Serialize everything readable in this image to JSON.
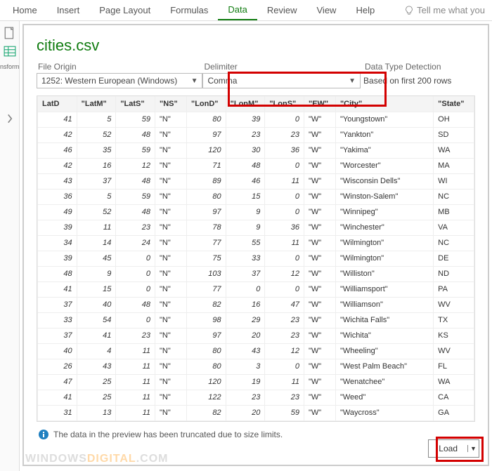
{
  "ribbon": {
    "tabs": [
      "Home",
      "Insert",
      "Page Layout",
      "Formulas",
      "Data",
      "Review",
      "View",
      "Help"
    ],
    "active_index": 4,
    "tell_me": "Tell me what you"
  },
  "leftbar": {
    "group_label": "nsform"
  },
  "dialog": {
    "title": "cities.csv",
    "file_origin": {
      "label": "File Origin",
      "value": "1252: Western European (Windows)"
    },
    "delimiter": {
      "label": "Delimiter",
      "value": "Comma"
    },
    "detection": {
      "label": "Data Type Detection",
      "value": "Based on first 200 rows"
    },
    "info": "The data in the preview has been truncated due to size limits.",
    "load_label": "Load"
  },
  "table": {
    "headers": [
      "LatD",
      "\"LatM\"",
      "\"LatS\"",
      "\"NS\"",
      "\"LonD\"",
      "\"LonM\"",
      "\"LonS\"",
      "\"EW\"",
      "\"City\"",
      "\"State\""
    ],
    "rows": [
      [
        41,
        5,
        59,
        "\"N\"",
        80,
        39,
        0,
        "\"W\"",
        "\"Youngstown\"",
        "OH"
      ],
      [
        42,
        52,
        48,
        "\"N\"",
        97,
        23,
        23,
        "\"W\"",
        "\"Yankton\"",
        "SD"
      ],
      [
        46,
        35,
        59,
        "\"N\"",
        120,
        30,
        36,
        "\"W\"",
        "\"Yakima\"",
        "WA"
      ],
      [
        42,
        16,
        12,
        "\"N\"",
        71,
        48,
        0,
        "\"W\"",
        "\"Worcester\"",
        "MA"
      ],
      [
        43,
        37,
        48,
        "\"N\"",
        89,
        46,
        11,
        "\"W\"",
        "\"Wisconsin Dells\"",
        "WI"
      ],
      [
        36,
        5,
        59,
        "\"N\"",
        80,
        15,
        0,
        "\"W\"",
        "\"Winston-Salem\"",
        "NC"
      ],
      [
        49,
        52,
        48,
        "\"N\"",
        97,
        9,
        0,
        "\"W\"",
        "\"Winnipeg\"",
        "MB"
      ],
      [
        39,
        11,
        23,
        "\"N\"",
        78,
        9,
        36,
        "\"W\"",
        "\"Winchester\"",
        "VA"
      ],
      [
        34,
        14,
        24,
        "\"N\"",
        77,
        55,
        11,
        "\"W\"",
        "\"Wilmington\"",
        "NC"
      ],
      [
        39,
        45,
        0,
        "\"N\"",
        75,
        33,
        0,
        "\"W\"",
        "\"Wilmington\"",
        "DE"
      ],
      [
        48,
        9,
        0,
        "\"N\"",
        103,
        37,
        12,
        "\"W\"",
        "\"Williston\"",
        "ND"
      ],
      [
        41,
        15,
        0,
        "\"N\"",
        77,
        0,
        0,
        "\"W\"",
        "\"Williamsport\"",
        "PA"
      ],
      [
        37,
        40,
        48,
        "\"N\"",
        82,
        16,
        47,
        "\"W\"",
        "\"Williamson\"",
        "WV"
      ],
      [
        33,
        54,
        0,
        "\"N\"",
        98,
        29,
        23,
        "\"W\"",
        "\"Wichita Falls\"",
        "TX"
      ],
      [
        37,
        41,
        23,
        "\"N\"",
        97,
        20,
        23,
        "\"W\"",
        "\"Wichita\"",
        "KS"
      ],
      [
        40,
        4,
        11,
        "\"N\"",
        80,
        43,
        12,
        "\"W\"",
        "\"Wheeling\"",
        "WV"
      ],
      [
        26,
        43,
        11,
        "\"N\"",
        80,
        3,
        0,
        "\"W\"",
        "\"West Palm Beach\"",
        "FL"
      ],
      [
        47,
        25,
        11,
        "\"N\"",
        120,
        19,
        11,
        "\"W\"",
        "\"Wenatchee\"",
        "WA"
      ],
      [
        41,
        25,
        11,
        "\"N\"",
        122,
        23,
        23,
        "\"W\"",
        "\"Weed\"",
        "CA"
      ],
      [
        31,
        13,
        11,
        "\"N\"",
        82,
        20,
        59,
        "\"W\"",
        "\"Waycross\"",
        "GA"
      ]
    ],
    "col_types": [
      "num",
      "num",
      "num",
      "str",
      "num",
      "num",
      "num",
      "str",
      "str",
      "str"
    ]
  },
  "watermark": {
    "a": "WINDOWS",
    "b": "DIGITAL",
    "c": ".COM"
  }
}
